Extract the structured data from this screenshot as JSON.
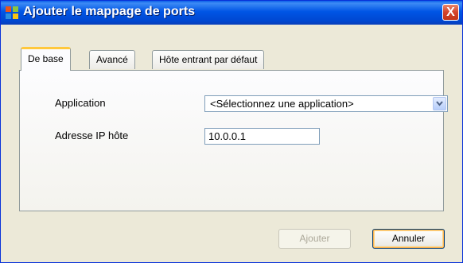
{
  "window": {
    "title": "Ajouter le mappage de ports",
    "close_label": "X"
  },
  "tabs": [
    {
      "label": "De base",
      "active": true
    },
    {
      "label": "Avancé",
      "active": false
    },
    {
      "label": "Hôte entrant par défaut",
      "active": false
    }
  ],
  "form": {
    "application_label": "Application",
    "application_value": "<Sélectionnez une application>",
    "ip_label": "Adresse IP hôte",
    "ip_value": "10.0.0.1"
  },
  "buttons": {
    "add_label": "Ajouter",
    "add_enabled": false,
    "cancel_label": "Annuler"
  },
  "colors": {
    "titlebar": "#0055E5",
    "close": "#D4432A",
    "active_tab_accent": "#FFC83C"
  }
}
